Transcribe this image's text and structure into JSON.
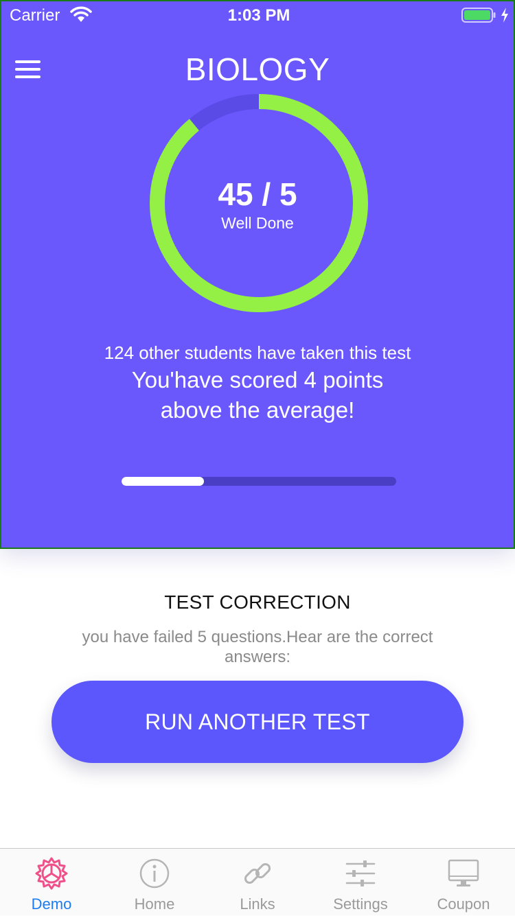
{
  "status_bar": {
    "carrier": "Carrier",
    "time": "1:03 PM"
  },
  "header": {
    "title": "BIOLOGY"
  },
  "score": {
    "value": "45 / 5",
    "label": "Well Done",
    "ring_fraction": 0.89,
    "colors": {
      "ring": "#95f046",
      "track": "#5b4be6",
      "panel": "#6b58fd"
    }
  },
  "summary": {
    "others_text": "124 other students have taken this test",
    "line1": "You'have scored 4 points",
    "line2": "above the average!"
  },
  "progress": {
    "fraction": 0.3
  },
  "correction": {
    "title": "TEST CORRECTION",
    "description": "you have failed 5 questions.Hear are the correct answers:",
    "button_label": "RUN ANOTHER TEST",
    "button_color": "#5b57fd"
  },
  "tabbar": {
    "active_color": "#1e7cf2",
    "active_icon_color": "#f0508a",
    "items": [
      {
        "label": "Demo",
        "icon": "aperture-icon",
        "active": true
      },
      {
        "label": "Home",
        "icon": "info-icon",
        "active": false
      },
      {
        "label": "Links",
        "icon": "link-icon",
        "active": false
      },
      {
        "label": "Settings",
        "icon": "sliders-icon",
        "active": false
      },
      {
        "label": "Coupon",
        "icon": "monitor-icon",
        "active": false
      }
    ]
  }
}
